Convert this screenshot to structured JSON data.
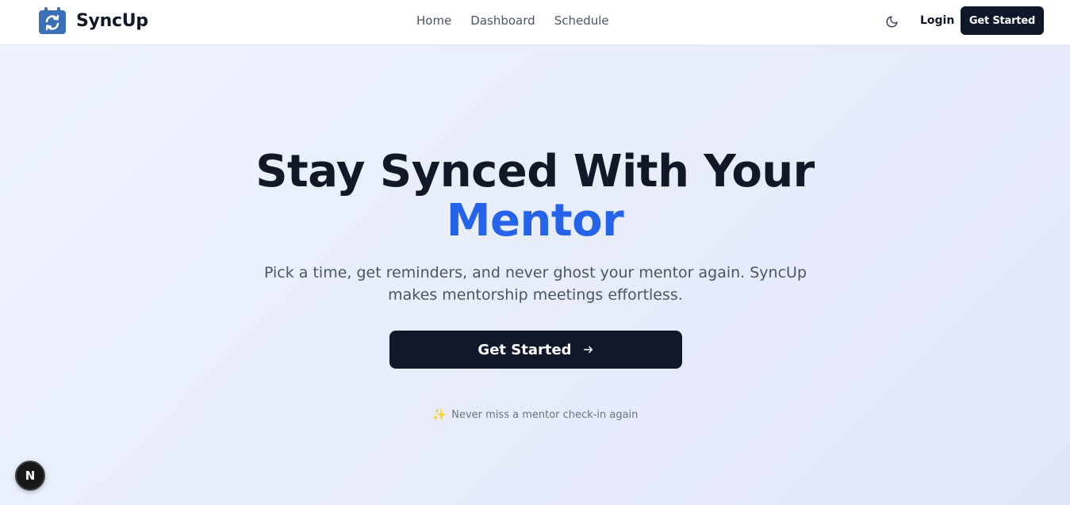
{
  "brand": {
    "name": "SyncUp",
    "icon": "calendar-sync-icon",
    "color": "#3b6fb6"
  },
  "nav": {
    "links": [
      "Home",
      "Dashboard",
      "Schedule"
    ],
    "theme_icon": "moon-icon",
    "login_label": "Login",
    "cta_label": "Get Started"
  },
  "hero": {
    "title_line1": "Stay Synced With Your",
    "title_accent": "Mentor",
    "subtitle": "Pick a time, get reminders, and never ghost your mentor again. SyncUp makes mentorship meetings effortless.",
    "cta_label": "Get Started",
    "cta_icon": "arrow-right-icon",
    "tagline_icon": "sparkles-icon",
    "tagline": "Never miss a mentor check-in again"
  },
  "dev_badge": {
    "label": "N"
  },
  "colors": {
    "accent": "#2563eb",
    "dark": "#0f172a"
  }
}
